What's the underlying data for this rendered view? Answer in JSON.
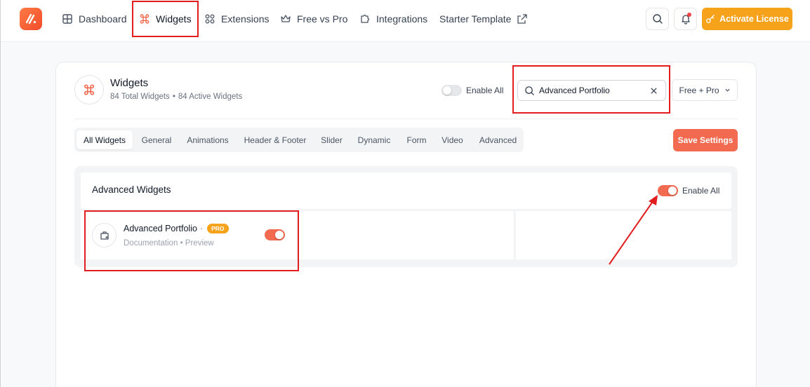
{
  "nav": {
    "items": [
      {
        "label": "Dashboard"
      },
      {
        "label": "Widgets"
      },
      {
        "label": "Extensions"
      },
      {
        "label": "Free vs Pro"
      },
      {
        "label": "Integrations"
      },
      {
        "label": "Starter Template"
      }
    ],
    "activate_label": "Activate License"
  },
  "header": {
    "title": "Widgets",
    "total": "84 Total Widgets",
    "active": "84 Active Widgets",
    "enable_all_label": "Enable All",
    "enable_all_on": false,
    "search_value": "Advanced Portfolio",
    "filter_label": "Free + Pro"
  },
  "tabs": [
    {
      "label": "All Widgets",
      "active": true
    },
    {
      "label": "General"
    },
    {
      "label": "Animations"
    },
    {
      "label": "Header & Footer"
    },
    {
      "label": "Slider"
    },
    {
      "label": "Dynamic"
    },
    {
      "label": "Form"
    },
    {
      "label": "Video"
    },
    {
      "label": "Advanced"
    }
  ],
  "save_label": "Save Settings",
  "section": {
    "title": "Advanced Widgets",
    "enable_all_label": "Enable All",
    "enable_all_on": true,
    "widgets": [
      {
        "name": "Advanced Portfolio",
        "separator": "·",
        "badge": "PRO",
        "doc_link": "Documentation",
        "link_sep": "•",
        "preview_link": "Preview",
        "enabled": true
      }
    ]
  },
  "colors": {
    "accent": "#f26a4f",
    "pro_badge": "#f7a21b",
    "annotation": "#e11d1d"
  }
}
